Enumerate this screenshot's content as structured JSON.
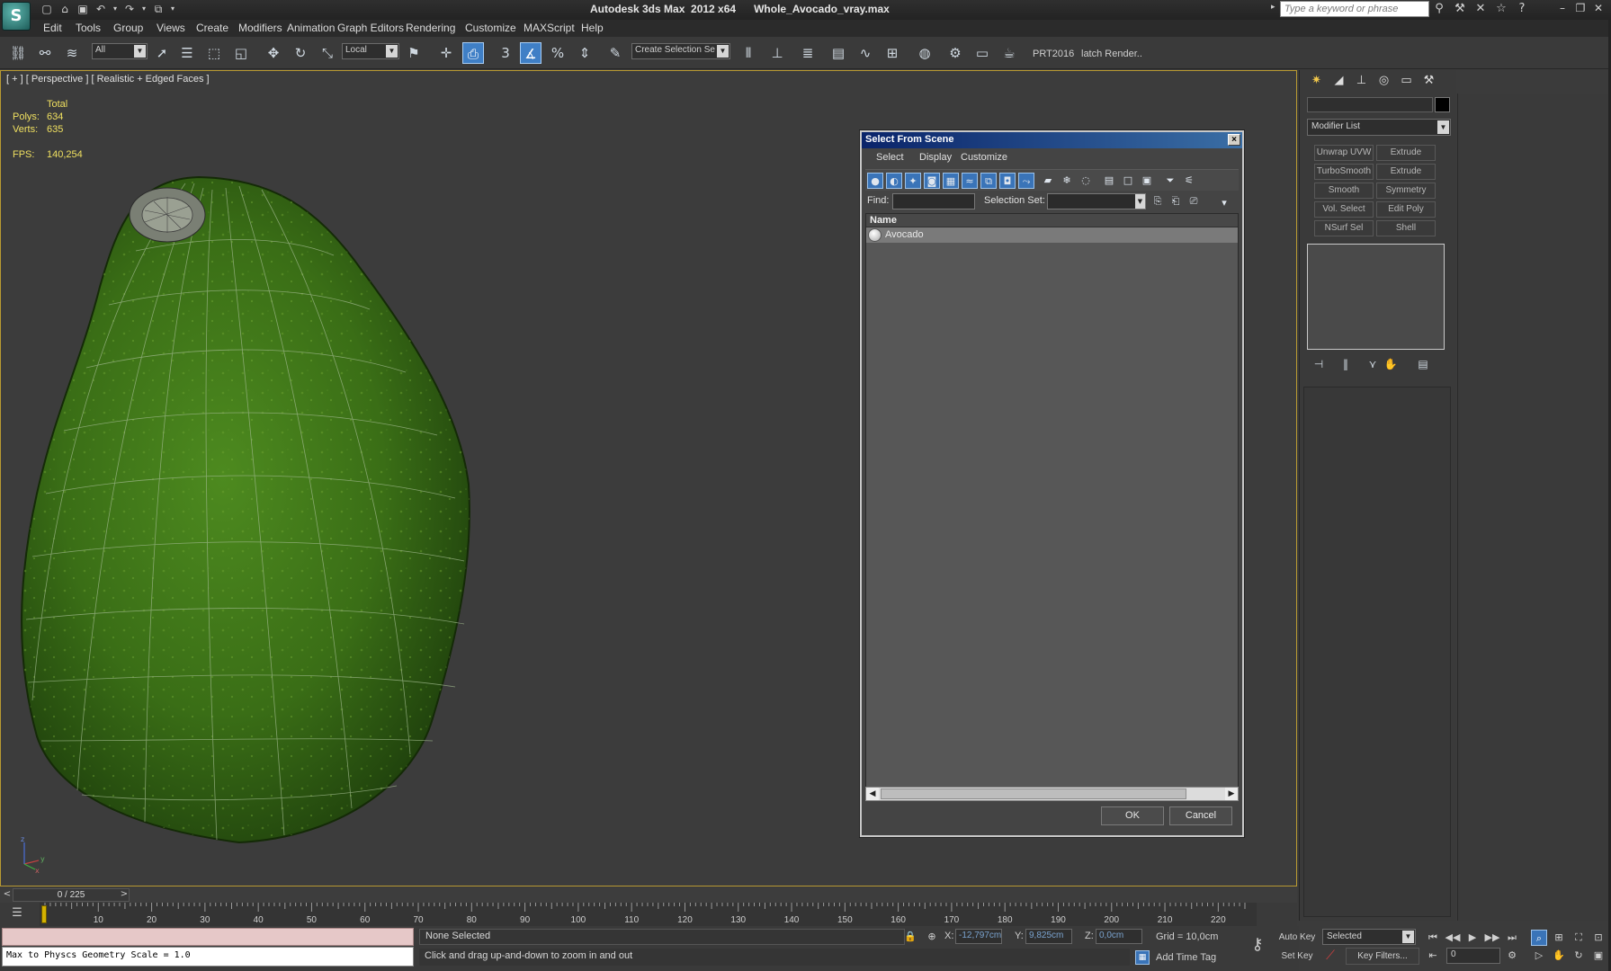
{
  "app": {
    "logo": "S",
    "title": "Autodesk 3ds Max  2012 x64      Whole_Avocado_vray.max",
    "search_placeholder": "Type a keyword or phrase"
  },
  "quick_access": [
    "new-icon",
    "open-icon",
    "save-icon",
    "undo-icon",
    "redo-icon",
    "project-icon"
  ],
  "menu": [
    "Edit",
    "Tools",
    "Group",
    "Views",
    "Create",
    "Modifiers",
    "Animation",
    "Graph Editors",
    "Rendering",
    "Customize",
    "MAXScript",
    "Help"
  ],
  "toolbar": {
    "filter_value": "All",
    "coord_system": "Local",
    "snap_angle_label": "3",
    "named_selection": "Create Selection Se",
    "prt_label": "PRT2016",
    "batch_render_label": "latch Render.."
  },
  "viewport": {
    "label": "[ + ] [ Perspective ] [ Realistic + Edged Faces ]",
    "stats": {
      "total_label": "Total",
      "polys_label": "Polys:",
      "polys_value": "634",
      "verts_label": "Verts:",
      "verts_value": "635",
      "fps_label": "FPS:",
      "fps_value": "140,254"
    },
    "gizmo": {
      "x": "x",
      "y": "y",
      "z": "z"
    }
  },
  "dialog": {
    "title": "Select From Scene",
    "close": "×",
    "menu": [
      "Select",
      "Display",
      "Customize"
    ],
    "find_label": "Find:",
    "selection_set_label": "Selection Set:",
    "list_header": "Name",
    "items": [
      "Avocado"
    ],
    "ok": "OK",
    "cancel": "Cancel"
  },
  "command_panel": {
    "modifier_list": "Modifier List",
    "modifier_buttons": [
      "Unwrap UVW",
      "Extrude",
      "TurboSmooth",
      "Extrude",
      "Smooth",
      "Symmetry",
      "Vol. Select",
      "Edit Poly",
      "NSurf Sel",
      "Shell"
    ]
  },
  "timeline": {
    "frame_display": "0 / 225",
    "ruler_labels": [
      "10",
      "20",
      "30",
      "40",
      "50",
      "60",
      "70",
      "80",
      "90",
      "100",
      "110",
      "120",
      "130",
      "140",
      "150",
      "160",
      "170",
      "180",
      "190",
      "200",
      "210",
      "220"
    ]
  },
  "status": {
    "maxscript_line": "Max to Physcs Geometry Scale = 1.0",
    "selection": "None Selected",
    "prompt": "Click and drag up-and-down to zoom in and out",
    "x_label": "X:",
    "x_value": "-12,797cm",
    "y_label": "Y:",
    "y_value": "9,825cm",
    "z_label": "Z:",
    "z_value": "0,0cm",
    "grid": "Grid = 10,0cm",
    "add_time_tag": "Add Time Tag"
  },
  "anim": {
    "auto_key": "Auto Key",
    "set_key": "Set Key",
    "key_mode": "Selected",
    "key_filters": "Key Filters...",
    "current_frame": "0"
  },
  "colors": {
    "accent": "#3f7fc6",
    "viewport_border": "#b89a32",
    "stats_text": "#f0e060",
    "avocado_dark": "#1e3d0c",
    "avocado_light": "#4f8a1f"
  }
}
